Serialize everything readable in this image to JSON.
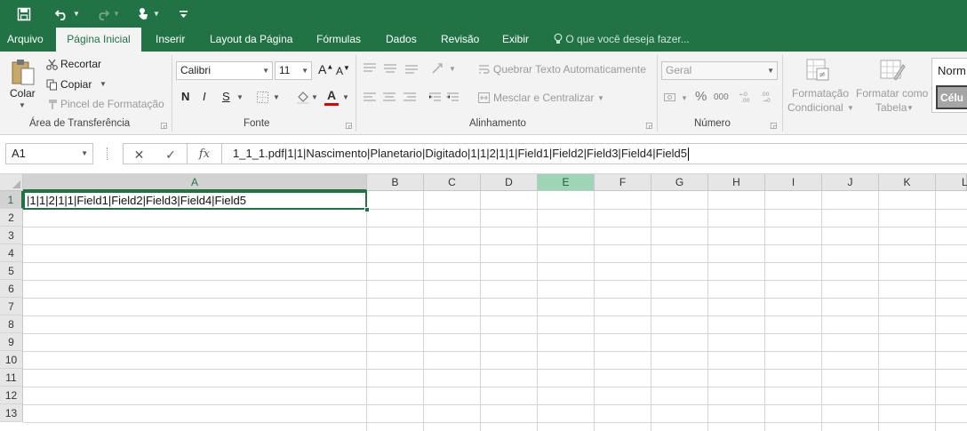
{
  "quick_access": {
    "save_icon": "save-icon",
    "undo_icon": "undo-icon",
    "redo_icon": "redo-icon",
    "touch_icon": "touch-mode-icon",
    "customize_icon": "customize-qat-icon"
  },
  "tabs": [
    {
      "label": "Arquivo"
    },
    {
      "label": "Página Inicial"
    },
    {
      "label": "Inserir"
    },
    {
      "label": "Layout da Página"
    },
    {
      "label": "Fórmulas"
    },
    {
      "label": "Dados"
    },
    {
      "label": "Revisão"
    },
    {
      "label": "Exibir"
    }
  ],
  "tell_me": "O que você deseja fazer...",
  "ribbon": {
    "clipboard": {
      "paste": "Colar",
      "cut": "Recortar",
      "copy": "Copiar",
      "format_painter": "Pincel de Formatação",
      "label": "Área de Transferência"
    },
    "font": {
      "name": "Calibri",
      "size": "11",
      "grow": "A",
      "shrink": "A",
      "bold": "N",
      "italic": "I",
      "underline": "S",
      "font_color_letter": "A",
      "label": "Fonte"
    },
    "alignment": {
      "wrap": "Quebrar Texto Automaticamente",
      "merge": "Mesclar e Centralizar",
      "label": "Alinhamento"
    },
    "number": {
      "format": "Geral",
      "percent": "%",
      "thousands": "000",
      "label": "Número"
    },
    "styles": {
      "conditional_line1": "Formatação",
      "conditional_line2": "Condicional",
      "table_line1": "Formatar como",
      "table_line2": "Tabela",
      "style_normal": "Norm",
      "style_cell": "Célu"
    }
  },
  "formula_bar": {
    "name_box": "A1",
    "cancel": "✕",
    "enter": "✓",
    "fx": "fx",
    "content": "1_1_1.pdf|1|1|Nascimento|Planetario|Digitado|1|1|2|1|1|Field1|Field2|Field3|Field4|Field5"
  },
  "grid": {
    "columns": [
      "A",
      "B",
      "C",
      "D",
      "E",
      "F",
      "G",
      "H",
      "I",
      "J",
      "K",
      "L"
    ],
    "rows": [
      "1",
      "2",
      "3",
      "4",
      "5",
      "6",
      "7",
      "8",
      "9",
      "10",
      "11",
      "12",
      "13"
    ],
    "cell_A1": "|1|1|2|1|1|Field1|Field2|Field3|Field4|Field5"
  },
  "colors": {
    "accent": "#217346",
    "highlight_column": "#9fd5b7"
  }
}
